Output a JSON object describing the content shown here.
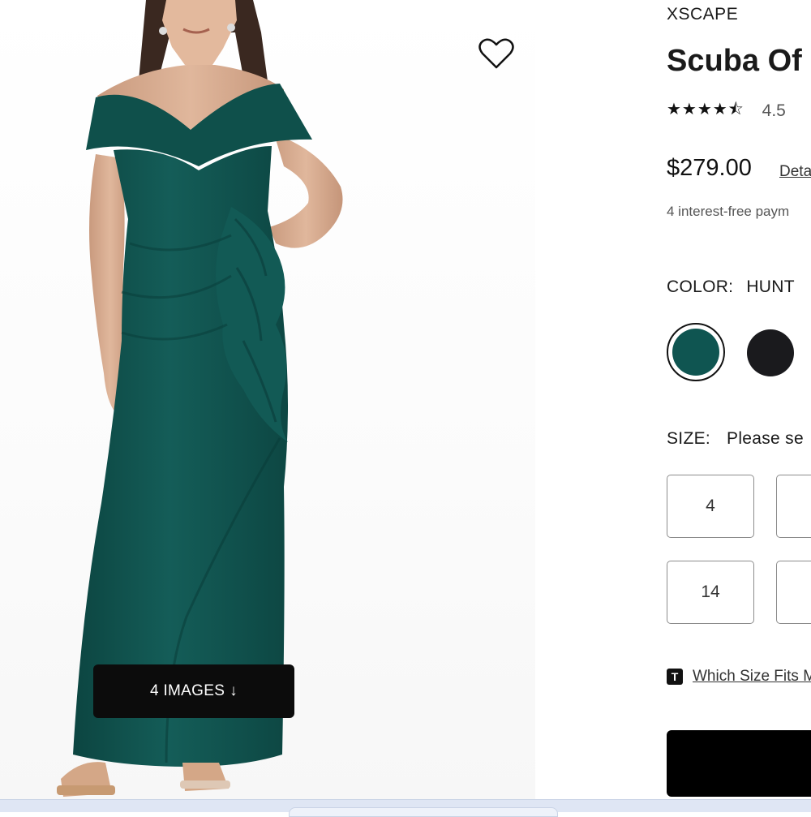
{
  "gallery": {
    "images_button": {
      "label": "4 IMAGES",
      "arrow": "↓"
    },
    "wishlist_icon": "heart-outline-icon"
  },
  "product": {
    "brand": "XSCAPE",
    "title": "Scuba Of",
    "rating": {
      "stars": "★★★★⯪",
      "value": "4.5"
    },
    "price": "$279.00",
    "details_link": "Deta",
    "payments": "4 interest-free paym"
  },
  "color": {
    "label": "COLOR:",
    "selected": "HUNT",
    "swatches": [
      {
        "name": "hunter-green",
        "hex": "#0f5551",
        "selected": true
      },
      {
        "name": "black",
        "hex": "#1a1a1d",
        "selected": false
      }
    ]
  },
  "size": {
    "label": "SIZE:",
    "prompt": "Please se",
    "options": [
      "4",
      "",
      "14",
      ""
    ]
  },
  "fit": {
    "icon": "T",
    "link": "Which Size Fits M"
  },
  "colors": {
    "dress": "#11504c",
    "button": "#0c0c0c",
    "accent": "#000000"
  }
}
